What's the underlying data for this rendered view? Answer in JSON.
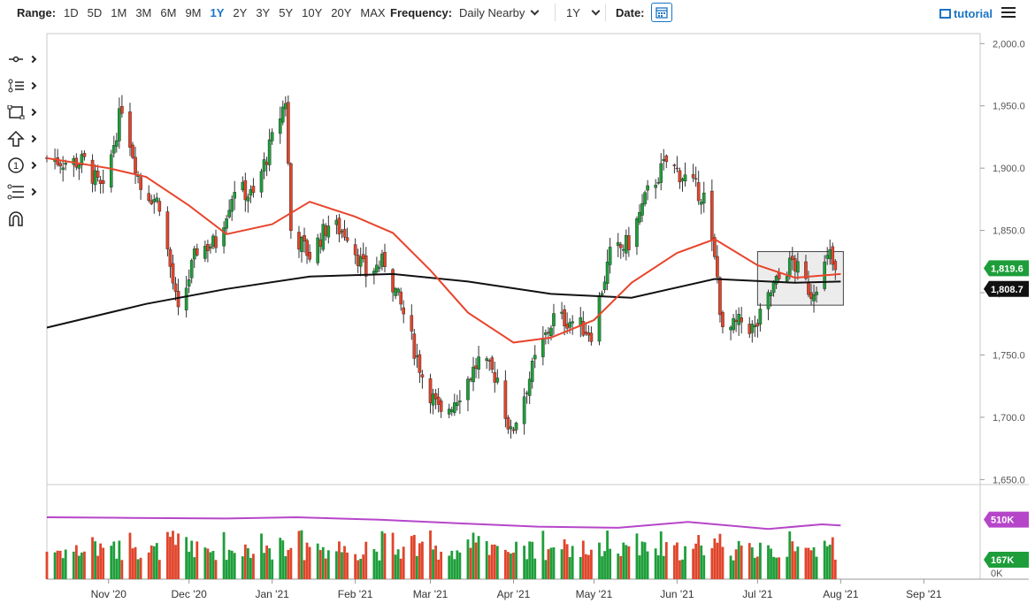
{
  "toolbar": {
    "range_label": "Range:",
    "ranges": [
      "1D",
      "5D",
      "1M",
      "3M",
      "6M",
      "9M",
      "1Y",
      "2Y",
      "3Y",
      "5Y",
      "10Y",
      "20Y",
      "MAX"
    ],
    "active_range": "1Y",
    "frequency_label": "Frequency:",
    "frequency_value": "Daily Nearby",
    "period_value": "1Y",
    "date_label": "Date:",
    "tutorial_label": "tutorial"
  },
  "sidebar": {
    "tools": [
      "crosshair-tool-icon",
      "line-tool-icon",
      "shape-tool-icon",
      "arrow-tool-icon",
      "counter-tool-icon",
      "fibonacci-tool-icon",
      "magnet-tool-icon"
    ]
  },
  "colors": {
    "up": "#1e9e3a",
    "down": "#e0452b",
    "ma_fast": "#e8452c",
    "ma_slow": "#111111",
    "vol_avg": "#b646c9",
    "accent": "#1b74c4"
  },
  "chart_data": {
    "type": "candlestick",
    "x_labels": [
      "Nov '20",
      "Dec '20",
      "Jan '21",
      "Feb '21",
      "Mar '21",
      "Apr '21",
      "May '21",
      "Jun '21",
      "Jul '21",
      "Aug '21",
      "Sep '21"
    ],
    "x_label_dates": [
      "2020-11-01",
      "2020-12-01",
      "2021-01-01",
      "2021-02-01",
      "2021-03-01",
      "2021-04-01",
      "2021-05-01",
      "2021-06-01",
      "2021-07-01",
      "2021-08-01",
      "2021-09-01"
    ],
    "x_range": [
      "2020-10-09",
      "2021-09-22"
    ],
    "y_ticks": [
      "2,000.0",
      "1,950.0",
      "1,900.0",
      "1,850.0",
      "1,800.0",
      "1,750.0",
      "1,700.0",
      "1,650.0"
    ],
    "y_tick_values": [
      2000,
      1950,
      1900,
      1850,
      1800,
      1750,
      1700,
      1650
    ],
    "ylim": [
      1646,
      2008
    ],
    "last_price_label": "1,819.6",
    "last_price": 1819.6,
    "ma_label": "1,808.7",
    "ma_value": 1808.7,
    "price_path": [
      [
        "2020-10-09",
        1908
      ],
      [
        "2020-10-16",
        1905
      ],
      [
        "2020-10-23",
        1905
      ],
      [
        "2020-10-30",
        1880
      ],
      [
        "2020-11-06",
        1950
      ],
      [
        "2020-11-13",
        1885
      ],
      [
        "2020-11-20",
        1872
      ],
      [
        "2020-11-27",
        1782
      ],
      [
        "2020-12-04",
        1835
      ],
      [
        "2020-12-11",
        1840
      ],
      [
        "2020-12-18",
        1885
      ],
      [
        "2020-12-25",
        1877
      ],
      [
        "2021-01-06",
        1955
      ],
      [
        "2021-01-08",
        1850
      ],
      [
        "2021-01-15",
        1830
      ],
      [
        "2021-01-22",
        1855
      ],
      [
        "2021-01-29",
        1848
      ],
      [
        "2021-02-05",
        1815
      ],
      [
        "2021-02-12",
        1825
      ],
      [
        "2021-02-19",
        1783
      ],
      [
        "2021-02-26",
        1734
      ],
      [
        "2021-03-05",
        1700
      ],
      [
        "2021-03-12",
        1720
      ],
      [
        "2021-03-19",
        1745
      ],
      [
        "2021-03-26",
        1732
      ],
      [
        "2021-03-31",
        1686
      ],
      [
        "2021-04-09",
        1745
      ],
      [
        "2021-04-16",
        1780
      ],
      [
        "2021-04-23",
        1777
      ],
      [
        "2021-04-30",
        1768
      ],
      [
        "2021-05-07",
        1830
      ],
      [
        "2021-05-14",
        1840
      ],
      [
        "2021-05-21",
        1880
      ],
      [
        "2021-05-28",
        1905
      ],
      [
        "2021-06-04",
        1892
      ],
      [
        "2021-06-11",
        1877
      ],
      [
        "2021-06-16",
        1812
      ],
      [
        "2021-06-18",
        1766
      ],
      [
        "2021-06-25",
        1777
      ],
      [
        "2021-06-30",
        1770
      ],
      [
        "2021-07-07",
        1805
      ],
      [
        "2021-07-14",
        1825
      ],
      [
        "2021-07-21",
        1800
      ],
      [
        "2021-07-28",
        1830
      ],
      [
        "2021-07-30",
        1814
      ]
    ],
    "ma_fast": [
      [
        "2020-10-09",
        1908
      ],
      [
        "2020-11-01",
        1900
      ],
      [
        "2020-11-15",
        1893
      ],
      [
        "2020-12-01",
        1870
      ],
      [
        "2020-12-15",
        1847
      ],
      [
        "2021-01-01",
        1855
      ],
      [
        "2021-01-15",
        1873
      ],
      [
        "2021-02-01",
        1861
      ],
      [
        "2021-02-15",
        1848
      ],
      [
        "2021-03-01",
        1818
      ],
      [
        "2021-03-15",
        1784
      ],
      [
        "2021-04-01",
        1760
      ],
      [
        "2021-04-15",
        1764
      ],
      [
        "2021-05-01",
        1778
      ],
      [
        "2021-05-15",
        1808
      ],
      [
        "2021-06-01",
        1832
      ],
      [
        "2021-06-15",
        1843
      ],
      [
        "2021-07-01",
        1822
      ],
      [
        "2021-07-15",
        1812
      ],
      [
        "2021-08-01",
        1815
      ]
    ],
    "ma_slow": [
      [
        "2020-10-09",
        1772
      ],
      [
        "2020-11-15",
        1791
      ],
      [
        "2020-12-15",
        1803
      ],
      [
        "2021-01-15",
        1813
      ],
      [
        "2021-02-15",
        1815
      ],
      [
        "2021-03-15",
        1809
      ],
      [
        "2021-04-15",
        1799
      ],
      [
        "2021-05-15",
        1796
      ],
      [
        "2021-06-15",
        1811
      ],
      [
        "2021-07-15",
        1808
      ],
      [
        "2021-08-01",
        1809
      ]
    ],
    "highlight_box": {
      "x_start": "2021-07-01",
      "x_end": "2021-08-02",
      "y_low": 1790,
      "y_high": 1833
    },
    "volume": {
      "avg_label": "510K",
      "avg_value": 510000,
      "last_label": "167K",
      "last_value": 167000,
      "zero_label": "0K",
      "ylim": [
        0,
        750000
      ],
      "avg_path": [
        [
          "2020-10-09",
          530000
        ],
        [
          "2020-11-10",
          525000
        ],
        [
          "2020-12-15",
          520000
        ],
        [
          "2021-01-10",
          530000
        ],
        [
          "2021-02-10",
          510000
        ],
        [
          "2021-03-10",
          480000
        ],
        [
          "2021-04-10",
          450000
        ],
        [
          "2021-05-10",
          440000
        ],
        [
          "2021-06-05",
          490000
        ],
        [
          "2021-07-05",
          430000
        ],
        [
          "2021-07-25",
          470000
        ],
        [
          "2021-08-01",
          460000
        ]
      ]
    }
  }
}
